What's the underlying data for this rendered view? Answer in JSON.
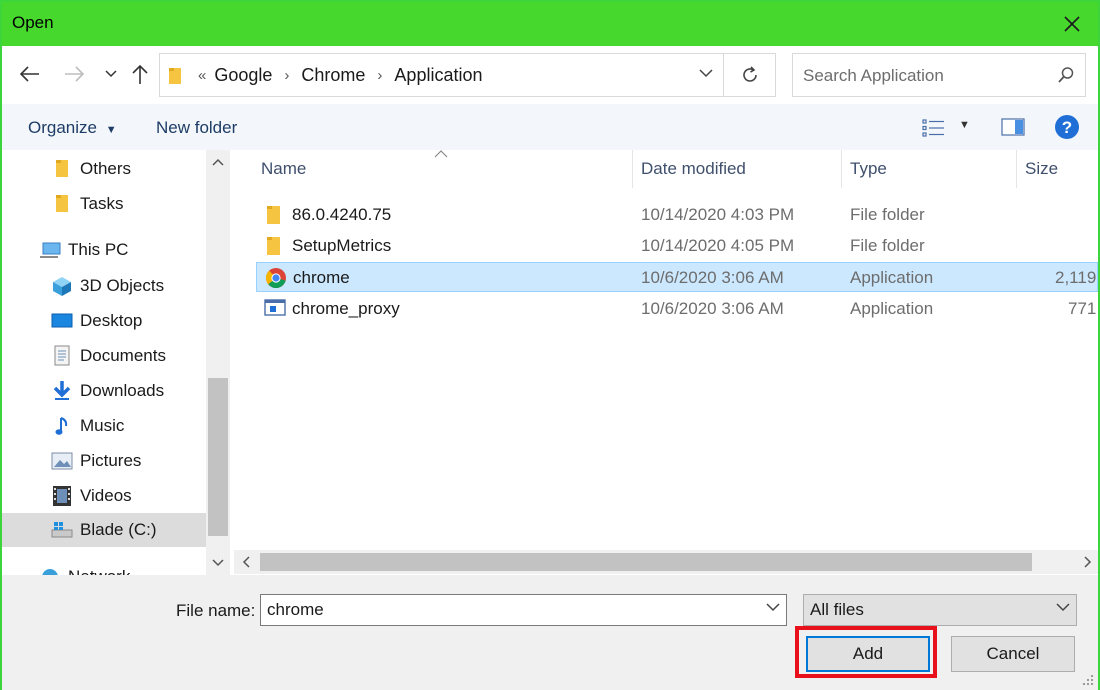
{
  "window": {
    "title": "Open"
  },
  "address": {
    "overflow": "«",
    "crumbs": [
      "Google",
      "Chrome",
      "Application"
    ]
  },
  "search": {
    "placeholder": "Search Application"
  },
  "toolbar": {
    "organize": "Organize",
    "new_folder": "New folder"
  },
  "nav": {
    "items": [
      {
        "label": "Others",
        "icon": "folder-icon"
      },
      {
        "label": "Tasks",
        "icon": "folder-icon"
      },
      {
        "label": "This PC",
        "icon": "computer-icon"
      },
      {
        "label": "3D Objects",
        "icon": "cube-icon"
      },
      {
        "label": "Desktop",
        "icon": "desktop-icon"
      },
      {
        "label": "Documents",
        "icon": "document-icon"
      },
      {
        "label": "Downloads",
        "icon": "download-icon"
      },
      {
        "label": "Music",
        "icon": "music-icon"
      },
      {
        "label": "Pictures",
        "icon": "pictures-icon"
      },
      {
        "label": "Videos",
        "icon": "video-icon"
      },
      {
        "label": "Blade (C:)",
        "icon": "drive-icon"
      },
      {
        "label": "Network",
        "icon": "network-icon"
      }
    ]
  },
  "columns": {
    "name": "Name",
    "date": "Date modified",
    "type": "Type",
    "size": "Size"
  },
  "files": [
    {
      "name": "86.0.4240.75",
      "date": "10/14/2020 4:03 PM",
      "type": "File folder",
      "size": "",
      "icon": "folder-icon"
    },
    {
      "name": "SetupMetrics",
      "date": "10/14/2020 4:05 PM",
      "type": "File folder",
      "size": "",
      "icon": "folder-icon"
    },
    {
      "name": "chrome",
      "date": "10/6/2020 3:06 AM",
      "type": "Application",
      "size": "2,119",
      "icon": "chrome-icon"
    },
    {
      "name": "chrome_proxy",
      "date": "10/6/2020 3:06 AM",
      "type": "Application",
      "size": "771",
      "icon": "app-window-icon"
    }
  ],
  "bottom": {
    "file_name_label": "File name:",
    "file_name_value": "chrome",
    "filter_value": "All files",
    "add_label": "Add",
    "cancel_label": "Cancel"
  },
  "colors": {
    "title_bar": "#47d82e",
    "selection": "#cce8ff",
    "highlight": "#e8111b"
  }
}
